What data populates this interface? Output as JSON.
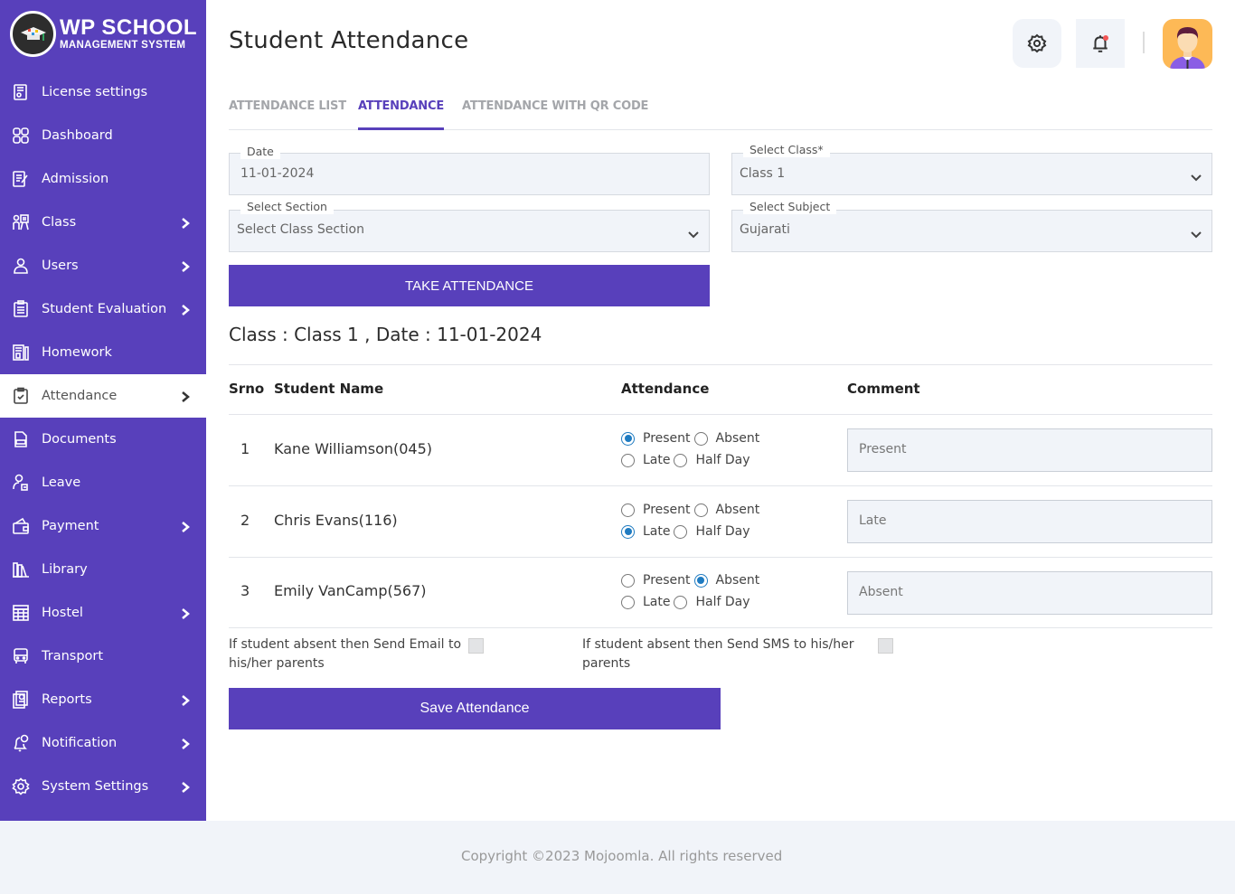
{
  "brand": {
    "title": "WP SCHOOL",
    "subtitle": "MANAGEMENT SYSTEM"
  },
  "sidebar": {
    "items": [
      {
        "label": "License settings",
        "icon": "license-icon",
        "has_submenu": false
      },
      {
        "label": "Dashboard",
        "icon": "dashboard-icon",
        "has_submenu": false
      },
      {
        "label": "Admission",
        "icon": "admission-icon",
        "has_submenu": false
      },
      {
        "label": "Class",
        "icon": "class-icon",
        "has_submenu": true
      },
      {
        "label": "Users",
        "icon": "user-icon",
        "has_submenu": true
      },
      {
        "label": "Student Evaluation",
        "icon": "evaluation-icon",
        "has_submenu": true
      },
      {
        "label": "Homework",
        "icon": "homework-icon",
        "has_submenu": false
      },
      {
        "label": "Attendance",
        "icon": "attendance-icon",
        "has_submenu": true,
        "active": true
      },
      {
        "label": "Documents",
        "icon": "document-icon",
        "has_submenu": false
      },
      {
        "label": "Leave",
        "icon": "leave-icon",
        "has_submenu": false
      },
      {
        "label": "Payment",
        "icon": "wallet-icon",
        "has_submenu": true
      },
      {
        "label": "Library",
        "icon": "library-icon",
        "has_submenu": false
      },
      {
        "label": "Hostel",
        "icon": "hostel-icon",
        "has_submenu": true
      },
      {
        "label": "Transport",
        "icon": "bus-icon",
        "has_submenu": false
      },
      {
        "label": "Reports",
        "icon": "report-icon",
        "has_submenu": true
      },
      {
        "label": "Notification",
        "icon": "notification-icon",
        "has_submenu": true
      },
      {
        "label": "System Settings",
        "icon": "gear-icon",
        "has_submenu": true
      }
    ]
  },
  "header": {
    "title": "Student Attendance",
    "has_notification": true
  },
  "tabs": [
    {
      "label": "ATTENDANCE LIST",
      "active": false
    },
    {
      "label": "ATTENDANCE",
      "active": true
    },
    {
      "label": "ATTENDANCE WITH QR CODE",
      "active": false
    }
  ],
  "form": {
    "date": {
      "label": "Date",
      "value": "11-01-2024"
    },
    "class": {
      "label": "Select Class*",
      "value": "Class 1"
    },
    "section": {
      "label": "Select Section",
      "value": "Select Class Section"
    },
    "subject": {
      "label": "Select Subject",
      "value": "Gujarati"
    },
    "take_attendance_label": "TAKE ATTENDANCE"
  },
  "summary": "Class : Class 1 , Date : 11-01-2024",
  "table": {
    "headers": {
      "srno": "Srno",
      "name": "Student Name",
      "attendance": "Attendance",
      "comment": "Comment"
    },
    "options": [
      "Present",
      "Absent",
      "Late",
      "Half Day"
    ],
    "rows": [
      {
        "srno": "1",
        "name": "Kane Williamson(045)",
        "status": "Present",
        "comment": "Present"
      },
      {
        "srno": "2",
        "name": "Chris Evans(116)",
        "status": "Late",
        "comment": "Late"
      },
      {
        "srno": "3",
        "name": "Emily VanCamp(567)",
        "status": "Absent",
        "comment": "Absent"
      }
    ]
  },
  "notify": {
    "email_label": "If student absent then Send Email to his/her parents",
    "email_checked": false,
    "sms_label": "If student absent then Send SMS to his/her parents",
    "sms_checked": false
  },
  "save_label": "Save Attendance",
  "footer": {
    "copyright": "Copyright ©2023 Mojoomla. All rights reserved"
  },
  "colors": {
    "brand": "#5840bb",
    "radio_checked": "#1f7bc1",
    "field_bg": "#f1f4f9"
  }
}
